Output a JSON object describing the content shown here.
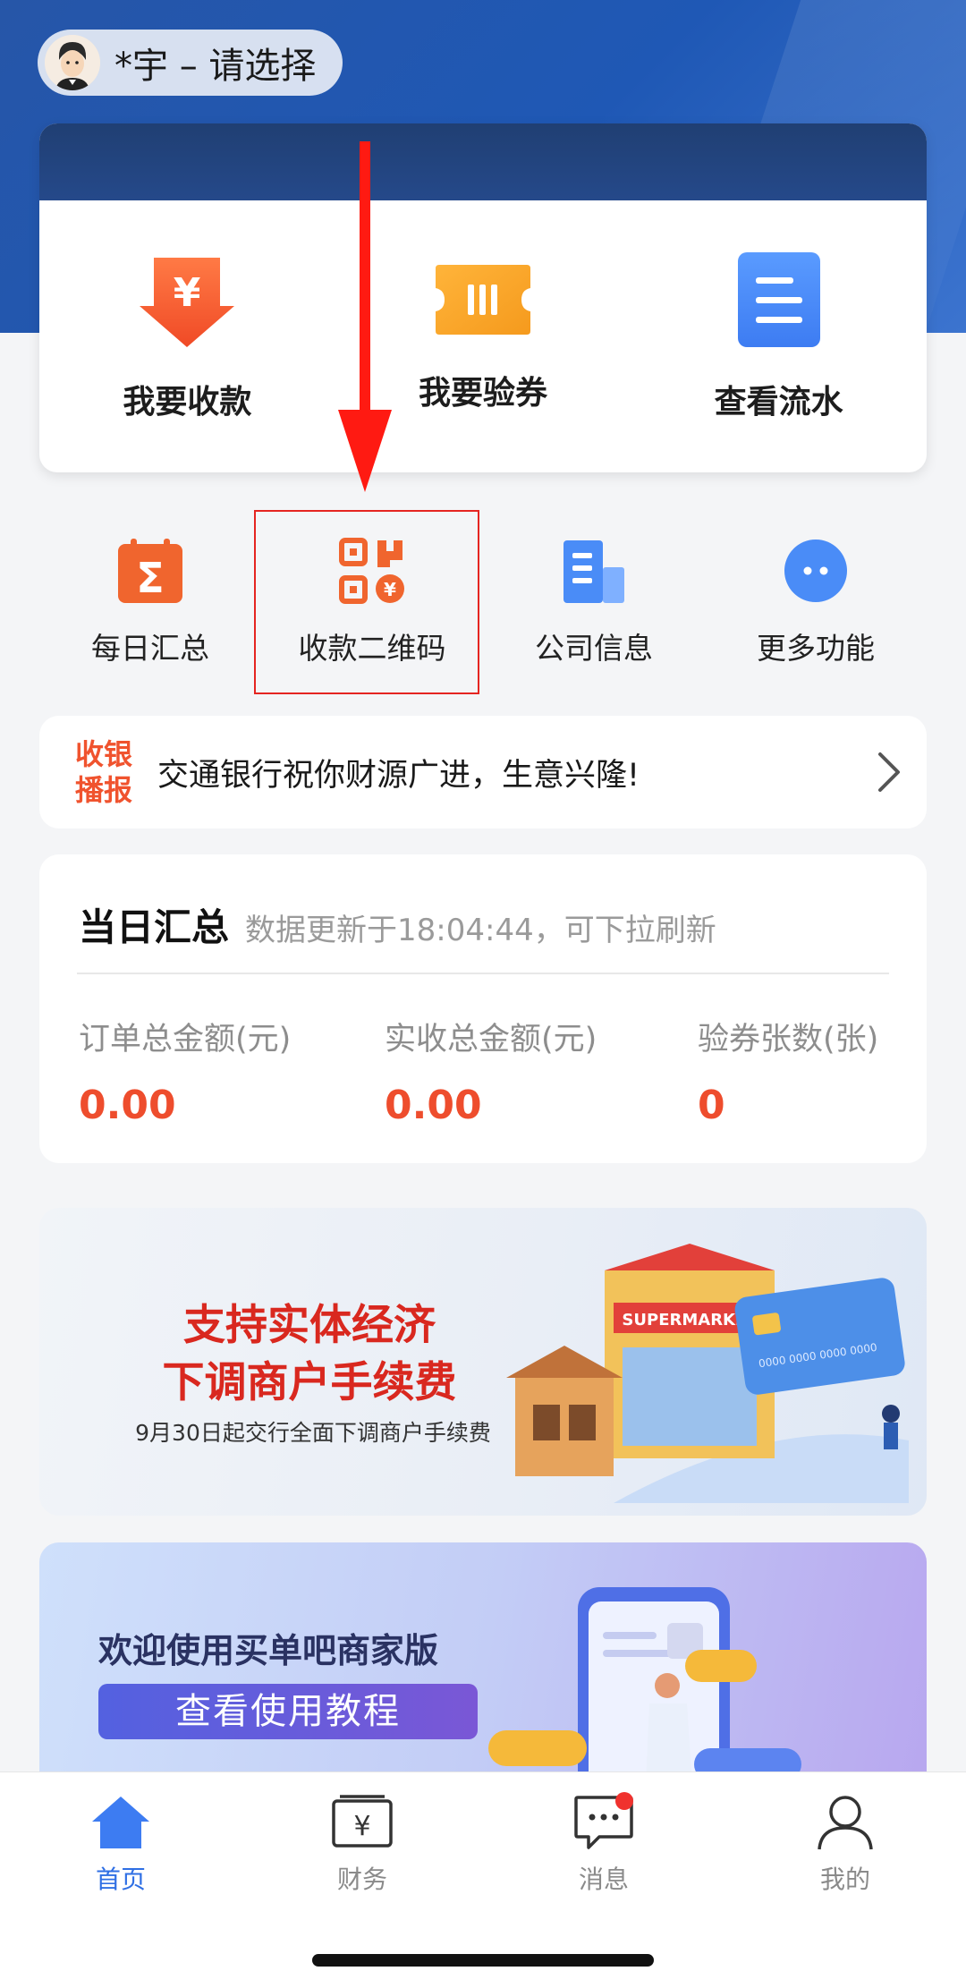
{
  "header": {
    "user_label": "*宇 – 请选择"
  },
  "quick_actions": [
    {
      "label": "我要收款",
      "icon": "yuan-down-arrow-icon",
      "color": "#f0532e"
    },
    {
      "label": "我要验券",
      "icon": "ticket-icon",
      "color": "#f5a623"
    },
    {
      "label": "查看流水",
      "icon": "document-list-icon",
      "color": "#4a8cf7"
    }
  ],
  "grid": [
    {
      "label": "每日汇总",
      "icon": "calendar-sigma-icon"
    },
    {
      "label": "收款二维码",
      "icon": "qr-code-icon"
    },
    {
      "label": "公司信息",
      "icon": "building-icon"
    },
    {
      "label": "更多功能",
      "icon": "more-dots-icon"
    }
  ],
  "notice": {
    "tag_line1": "收银",
    "tag_line2": "播报",
    "message": "交通银行祝你财源广进，生意兴隆!"
  },
  "summary": {
    "title": "当日汇总",
    "subtitle": "数据更新于18:04:44，可下拉刷新",
    "stats": [
      {
        "label": "订单总金额(元)",
        "value": "0.00"
      },
      {
        "label": "实收总金额(元)",
        "value": "0.00"
      },
      {
        "label": "验券张数(张)",
        "value": "0"
      }
    ]
  },
  "banner1": {
    "title_line1": "支持实体经济",
    "title_line2": "下调商户手续费",
    "subtitle": "9月30日起交行全面下调商户手续费",
    "store_sign": "SUPERMARKET",
    "card_number": "0000 0000 0000 0000"
  },
  "banner2": {
    "title": "欢迎使用买单吧商家版",
    "button": "查看使用教程"
  },
  "tabbar": [
    {
      "label": "首页",
      "icon": "home-icon",
      "active": true
    },
    {
      "label": "财务",
      "icon": "finance-yuan-icon"
    },
    {
      "label": "消息",
      "icon": "message-icon",
      "badge": true
    },
    {
      "label": "我的",
      "icon": "person-icon"
    }
  ],
  "colors": {
    "primary": "#2f6fe4",
    "accent": "#f0532e",
    "highlight": "#e52521"
  }
}
